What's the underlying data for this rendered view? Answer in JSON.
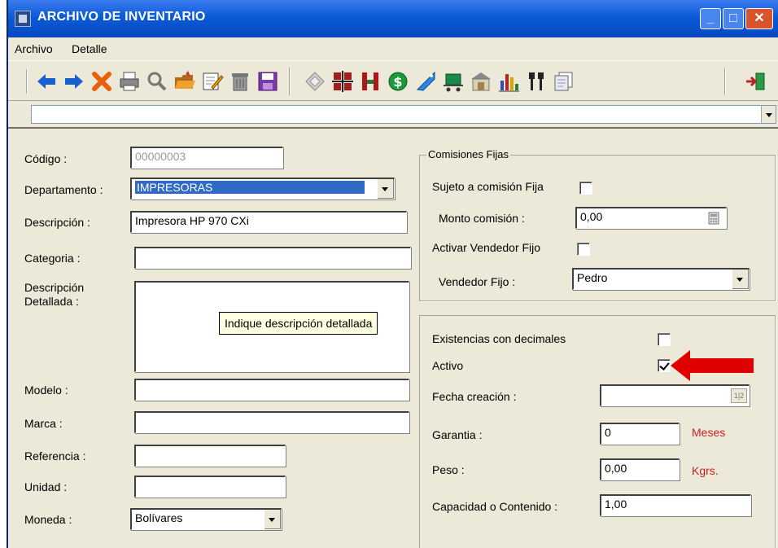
{
  "window": {
    "title": "ARCHIVO DE INVENTARIO"
  },
  "menu": [
    "Archivo",
    "Detalle"
  ],
  "form": {
    "codigo": {
      "label": "Código :",
      "value": "00000003"
    },
    "departamento": {
      "label": "Departamento :",
      "value": "IMPRESORAS"
    },
    "descripcion": {
      "label": "Descripción :",
      "value": "Impresora HP 970 CXi"
    },
    "categoria": {
      "label": "Categoria :",
      "value": ""
    },
    "descripcion_detallada": {
      "label_line1": "Descripción",
      "label_line2": "Detallada :",
      "value": "",
      "tooltip": "Indique descripción detallada"
    },
    "modelo": {
      "label": "Modelo :",
      "value": ""
    },
    "marca": {
      "label": "Marca :",
      "value": ""
    },
    "referencia": {
      "label": "Referencia :",
      "value": ""
    },
    "unidad": {
      "label": "Unidad :",
      "value": ""
    },
    "moneda": {
      "label": "Moneda :",
      "value": "Bolívares"
    }
  },
  "comisiones": {
    "legend": "Comisiones Fijas",
    "sujeto": {
      "label": "Sujeto a comisión Fija",
      "checked": false
    },
    "monto": {
      "label": "Monto comisión :",
      "value": "0,00"
    },
    "activar_vendedor": {
      "label": "Activar Vendedor Fijo",
      "checked": false
    },
    "vendedor": {
      "label": "Vendedor Fijo :",
      "value": "Pedro"
    }
  },
  "otros": {
    "existencias_decimales": {
      "label": "Existencias con decimales",
      "checked": false
    },
    "activo": {
      "label": "Activo",
      "checked": true
    },
    "fecha_creacion": {
      "label": "Fecha creación :",
      "value": ""
    },
    "garantia": {
      "label": "Garantia :",
      "value": "0",
      "unit": "Meses"
    },
    "peso": {
      "label": "Peso :",
      "value": "0,00",
      "unit": "Kgrs."
    },
    "capacidad": {
      "label": "Capacidad o Contenido :",
      "value": "1,00"
    }
  },
  "colors": {
    "title_bar": "#0a5bd6",
    "unit_text": "#c62020",
    "highlight": "#316ac5",
    "annotation_arrow": "#e00000"
  }
}
